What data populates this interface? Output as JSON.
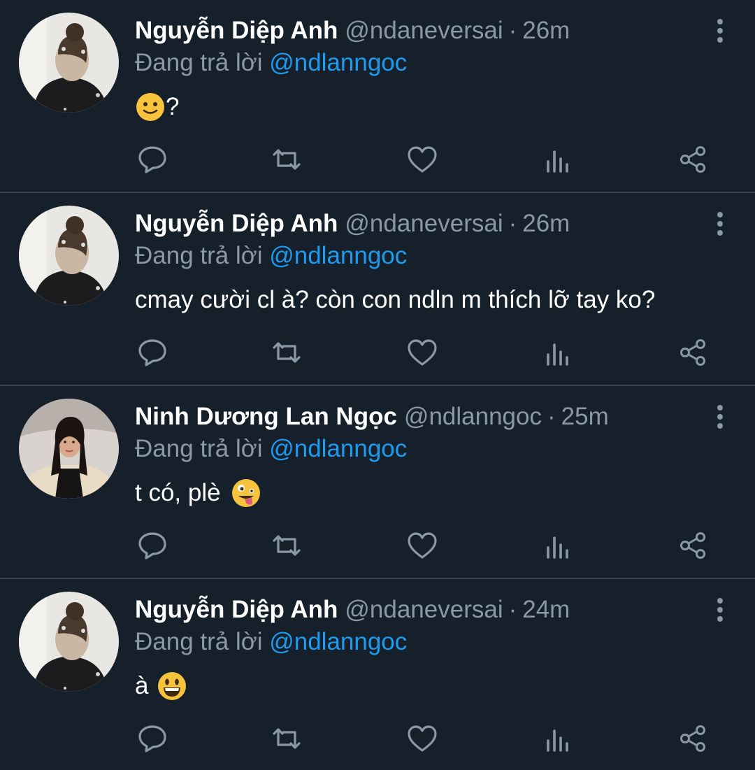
{
  "colors": {
    "background": "#15202b",
    "divider": "#38444d",
    "secondary_text": "#8b98a5",
    "mention": "#1d9bf0"
  },
  "tweets": [
    {
      "display_name": "Nguyễn Diệp Anh",
      "handle": "@ndaneversai",
      "dot": "·",
      "time": "26m",
      "replying_prefix": "Đang trả lời",
      "replying_to": "@ndlanngoc",
      "text": "",
      "text_after_emoji": "?",
      "emoji": "slightly-smiling-face",
      "avatar": "woman-back-view-hair-bun"
    },
    {
      "display_name": "Nguyễn Diệp Anh",
      "handle": "@ndaneversai",
      "dot": "·",
      "time": "26m",
      "replying_prefix": "Đang trả lời",
      "replying_to": "@ndlanngoc",
      "text": "cmay cười cl à? còn con ndln m thích lỡ tay ko?",
      "avatar": "woman-back-view-hair-bun"
    },
    {
      "display_name": "Ninh Dương Lan Ngọc",
      "handle": "@ndlanngoc",
      "dot": "·",
      "time": "25m",
      "replying_prefix": "Đang trả lời",
      "replying_to": "@ndlanngoc",
      "text": "t có, plè",
      "emoji": "zany-face",
      "avatar": "woman-long-hair-portrait"
    },
    {
      "display_name": "Nguyễn Diệp Anh",
      "handle": "@ndaneversai",
      "dot": "·",
      "time": "24m",
      "replying_prefix": "Đang trả lời",
      "replying_to": "@ndlanngoc",
      "text": "à",
      "emoji": "grinning-face",
      "avatar": "woman-back-view-hair-bun"
    }
  ],
  "action_icons": [
    "reply-icon",
    "retweet-icon",
    "like-icon",
    "analytics-icon",
    "share-icon"
  ]
}
